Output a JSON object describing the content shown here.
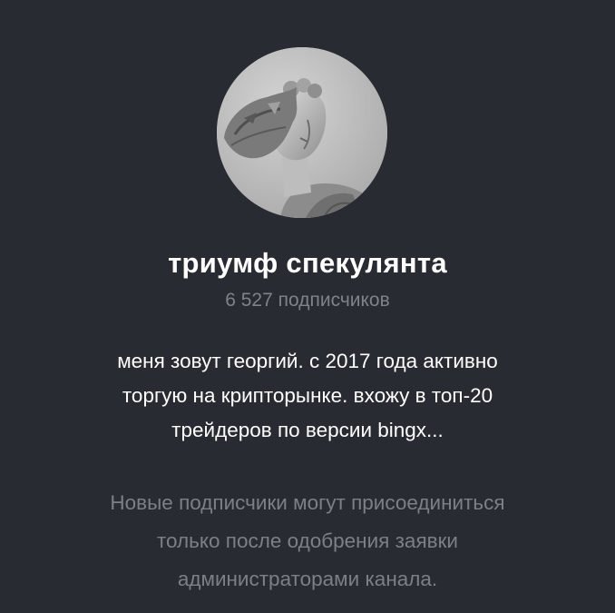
{
  "channel": {
    "avatar_icon": "statue-head-avatar",
    "title": "триумф спекулянта",
    "subscribers": "6 527 подписчиков",
    "description_lines": [
      "меня зовут георгий. с 2017 года активно",
      "торгую на крипторынке. вхожу в топ-20",
      "трейдеров по версии bingx..."
    ],
    "notice_lines": [
      "Новые подписчики могут присоединиться",
      "только после одобрения заявки",
      "администраторами канала."
    ]
  },
  "colors": {
    "background": "#282c32",
    "title": "#ffffff",
    "muted": "#7f8389"
  }
}
